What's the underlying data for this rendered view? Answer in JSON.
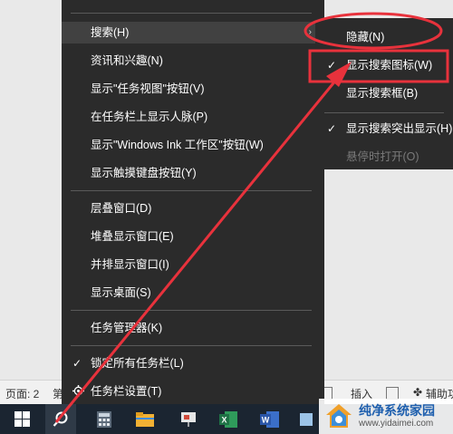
{
  "menu": {
    "items": [
      {
        "label": "搜索(H)",
        "arrow": "›",
        "highlight": true
      },
      {
        "label": "资讯和兴趣(N)",
        "arrow": "›"
      },
      {
        "label": "显示\"任务视图\"按钮(V)"
      },
      {
        "label": "在任务栏上显示人脉(P)"
      },
      {
        "label": "显示\"Windows Ink 工作区\"按钮(W)"
      },
      {
        "label": "显示触摸键盘按钮(Y)"
      },
      {
        "label": "层叠窗口(D)"
      },
      {
        "label": "堆叠显示窗口(E)"
      },
      {
        "label": "并排显示窗口(I)"
      },
      {
        "label": "显示桌面(S)"
      },
      {
        "label": "任务管理器(K)"
      },
      {
        "label": "锁定所有任务栏(L)",
        "check": "✓"
      },
      {
        "label": "任务栏设置(T)",
        "icon": "gear-icon"
      }
    ]
  },
  "submenu": {
    "items": [
      {
        "label": "隐藏(N)"
      },
      {
        "label": "显示搜索图标(W)",
        "check": "✓"
      },
      {
        "label": "显示搜索框(B)"
      },
      {
        "label": "显示搜索突出显示(H)",
        "check": "✓"
      },
      {
        "label": "悬停时打开(O)",
        "disabled": true
      }
    ]
  },
  "statusbar": {
    "page": "页面: 2",
    "partial": "第",
    "insert": "插入",
    "accessibility": "辅助功"
  },
  "watermark": {
    "title": "纯净系统家园",
    "url": "www.yidaimei.com"
  },
  "colors": {
    "annotation": "#e8323c",
    "menu_bg": "#2b2b2b",
    "taskbar_bg": "#1b2531"
  },
  "icons": [
    "windows-start-icon",
    "search-icon",
    "calculator-icon",
    "file-explorer-icon",
    "presentation-icon",
    "excel-icon",
    "word-icon",
    "gear-icon"
  ]
}
